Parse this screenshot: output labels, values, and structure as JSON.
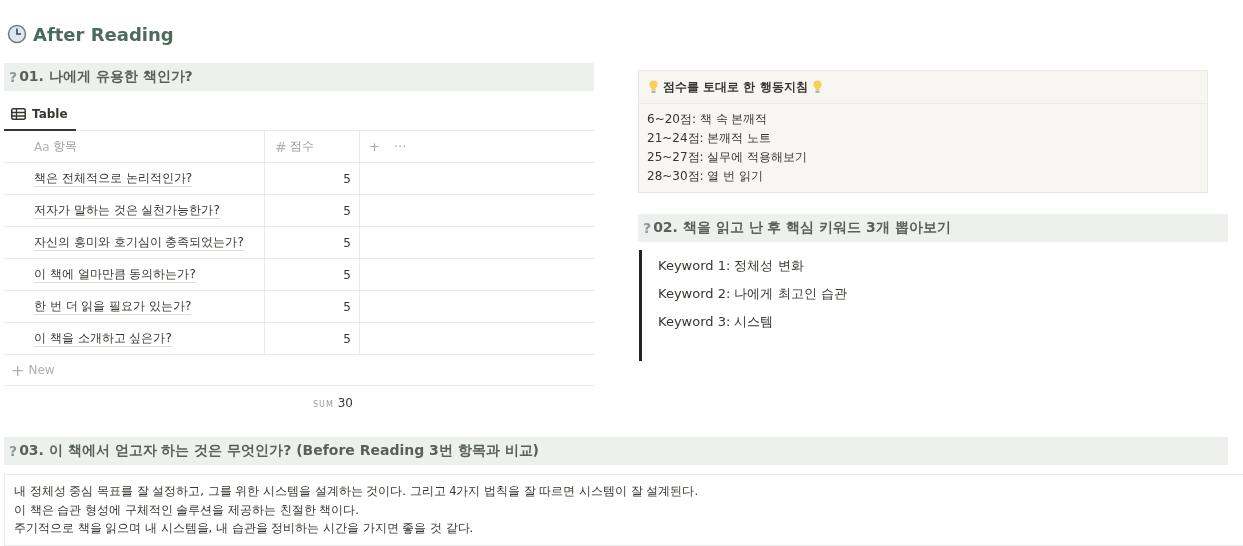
{
  "page": {
    "title": "After Reading"
  },
  "section_1": {
    "heading": {
      "marker": "?",
      "text": "01. 나에게 유용한 책인가?"
    },
    "tabs": [
      {
        "label": "Table",
        "selected": true
      }
    ],
    "table": {
      "columns": [
        {
          "type_mark": "Aa",
          "label": "항목"
        },
        {
          "type_mark": "#",
          "label": "점수"
        }
      ],
      "add_column": "+",
      "more": "···",
      "rows": [
        {
          "item": "책은 전체적으로 논리적인가?",
          "score": "5"
        },
        {
          "item": "저자가 말하는 것은 실천가능한가?",
          "score": "5"
        },
        {
          "item": "자신의 흥미와 호기심이 충족되었는가?",
          "score": "5"
        },
        {
          "item": "이 책에 얼마만큼 동의하는가?",
          "score": "5"
        },
        {
          "item": "한 번 더 읽을 필요가 있는가?",
          "score": "5"
        },
        {
          "item": "이 책을 소개하고 싶은가?",
          "score": "5"
        }
      ],
      "new_row": {
        "plus": "+",
        "label": "New"
      },
      "footer": {
        "label": "SUM",
        "value": "30"
      }
    }
  },
  "callout": {
    "title": "점수를 토대로 한 행동지침",
    "lines": [
      "6~20점: 책 속 본깨적",
      "21~24점: 본깨적 노트",
      "25~27점: 실무에 적용해보기",
      "28~30점: 열 번 읽기"
    ]
  },
  "section_2": {
    "heading": {
      "marker": "?",
      "text": "02. 책을 읽고 난 후 핵심 키워드 3개 뽑아보기"
    },
    "keywords": [
      "Keyword 1: 정체성 변화",
      "Keyword 2: 나에게 최고인 습관",
      "Keyword 3: 시스템"
    ]
  },
  "section_3": {
    "heading": {
      "marker": "?",
      "text": "03. 이 책에서 얻고자 하는 것은 무엇인가? (Before Reading 3번 항목과 비교)"
    },
    "lines": [
      "내 정체성 중심 목표를 잘 설정하고, 그를 위한 시스템을 설계하는 것이다. 그리고 4가지 법칙을 잘 따르면 시스템이 잘 설계된다.",
      "이 책은 습관 형성에 구체적인 솔루션을 제공하는 친절한 책이다.",
      "주기적으로 책을 읽으며 내 시스템을, 내 습관을 정비하는 시간을 가지면 좋을 것 같다."
    ]
  }
}
